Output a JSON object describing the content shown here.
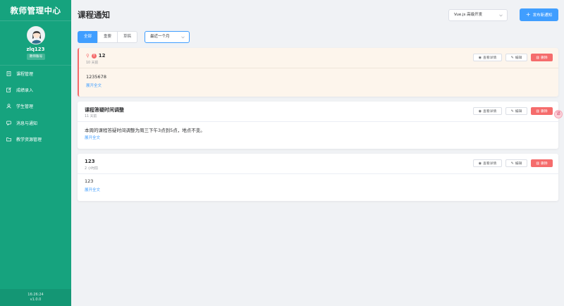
{
  "sidebar": {
    "brand": "教师管理中心",
    "user": {
      "name": "zlq123",
      "role": "教师账号"
    },
    "menu": [
      {
        "label": "课程管理",
        "icon": "document-icon"
      },
      {
        "label": "成绩录入",
        "icon": "edit-icon"
      },
      {
        "label": "学生管理",
        "icon": "users-icon"
      },
      {
        "label": "消息与通知",
        "icon": "message-icon"
      },
      {
        "label": "教学资源管理",
        "icon": "folder-icon"
      }
    ],
    "footer": {
      "time": "16:26:24",
      "version": "v1.0.0"
    }
  },
  "header": {
    "title": "课程通知",
    "course_select": "Vue.js 高级开发",
    "publish_label": "发布新通知"
  },
  "filters": {
    "tabs": [
      "全部",
      "重要",
      "草稿"
    ],
    "active_tab": "全部",
    "range": "最近一个月"
  },
  "actions": {
    "view": "查看详情",
    "edit": "编辑",
    "delete": "删除"
  },
  "notices": [
    {
      "title": "12",
      "time": "10 天前",
      "body": "1235678",
      "expand": "展开全文",
      "pinned": true,
      "urgent": true
    },
    {
      "title": "课程答疑时间调整",
      "time": "11 天前",
      "body": "本周的课程答疑时间调整为周三下午3点到5点，地点不变。",
      "expand": "展开全文",
      "pinned": false,
      "urgent": false
    },
    {
      "title": "123",
      "time": "2 小时前",
      "body": "123",
      "expand": "展开全文",
      "pinned": false,
      "urgent": false
    }
  ],
  "colors": {
    "sidebar": "#16a37e",
    "primary": "#409eff",
    "danger": "#f56c6c",
    "highlight_bg": "#fdf5ec"
  },
  "float_button": "译"
}
